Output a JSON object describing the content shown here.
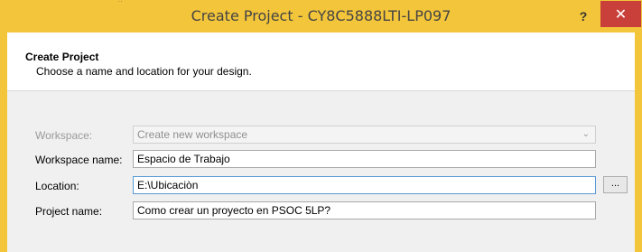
{
  "window": {
    "title": "Create Project - CY8C5888LTI-LP097",
    "help_label": "?",
    "close_label": "✕",
    "title_marks": "˙˙"
  },
  "header": {
    "title": "Create Project",
    "subtitle": "Choose a name and location for your design."
  },
  "form": {
    "workspace": {
      "label": "Workspace:",
      "value": "Create new workspace",
      "enabled": false
    },
    "workspace_name": {
      "label": "Workspace name:",
      "value": "Espacio de Trabajo"
    },
    "location": {
      "label": "Location:",
      "value": "E:\\Ubicaciòn"
    },
    "project_name": {
      "label": "Project name:",
      "value": "Como crear un proyecto en PSOC 5LP?"
    },
    "browse_label": "..."
  },
  "colors": {
    "frame": "#f3c53a",
    "close": "#c9403a",
    "focus_border": "#5a9bd5"
  }
}
